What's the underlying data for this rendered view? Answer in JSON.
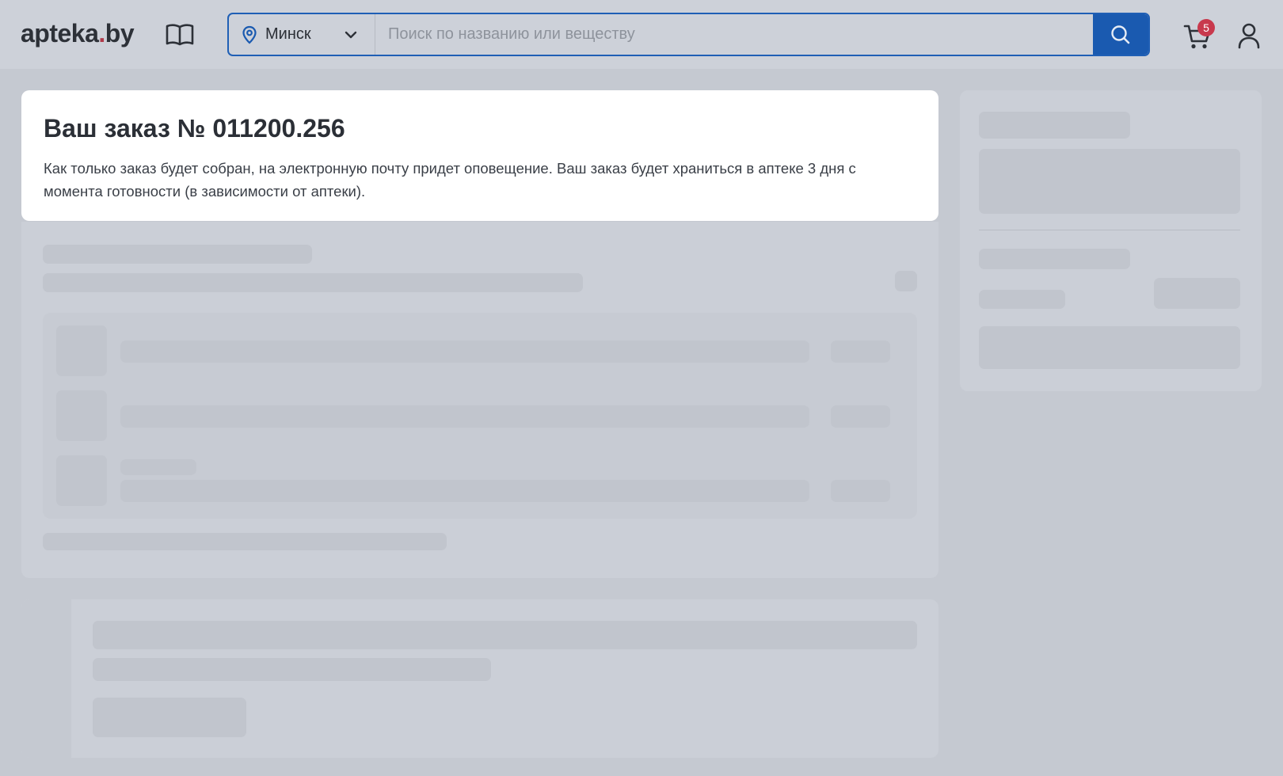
{
  "header": {
    "logo_main": "apteka",
    "logo_dot": ".",
    "logo_tld": "by",
    "city": "Минск",
    "search_placeholder": "Поиск по названию или веществу",
    "cart_count": "5"
  },
  "order": {
    "title": "Ваш заказ № 011200.256",
    "message": "Как только заказ будет собран, на электронную почту придет оповещение. Ваш заказ будет храниться в аптеке 3 дня с момента готовности (в зависимости от аптеки)."
  },
  "colors": {
    "accent": "#1a5ab0",
    "badge": "#c8394d",
    "logo_dot": "#b03a4a"
  },
  "icons": [
    "book-icon",
    "location-pin-icon",
    "chevron-down-icon",
    "search-icon",
    "cart-icon",
    "user-icon"
  ]
}
